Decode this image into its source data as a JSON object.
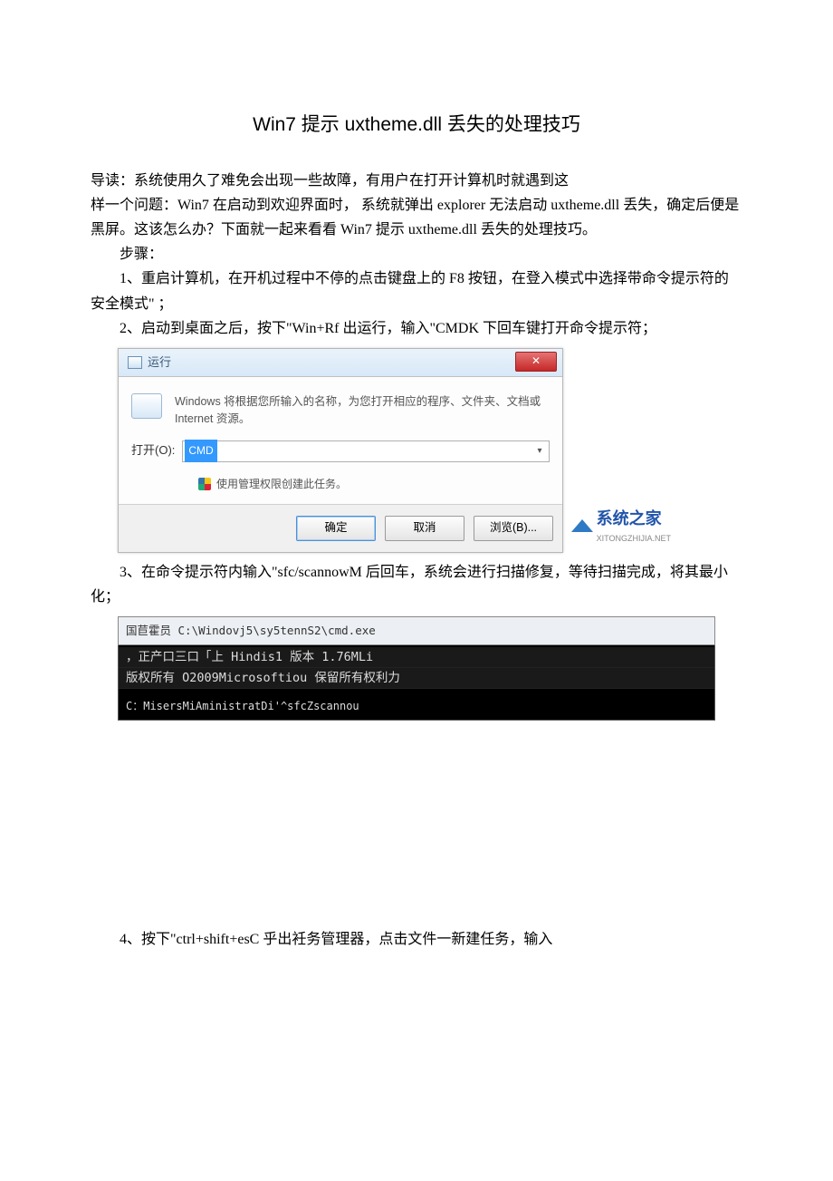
{
  "title": "Win7 提示 uxtheme.dll 丢失的处理技巧",
  "intro": {
    "p1": "导读：系统使用久了难免会出现一些故障，有用户在打开计算机时就遇到这",
    "p2": "样一个问题：Win7 在启动到欢迎界面时， 系统就弹出 explorer 无法启动 uxtheme.dll 丢失，确定后便是黑屏。这该怎么办？下面就一起来看看 Win7 提示 uxtheme.dll 丢失的处理技巧。"
  },
  "steps_header": "步骤：",
  "step1": "1、重启计算机，在开机过程中不停的点击键盘上的 F8 按钮，在登入模式中选择带命令提示符的安全模式\" ；",
  "step2": "2、启动到桌面之后，按下\"Win+Rf 出运行，输入\"CMDK 下回车键打开命令提示符；",
  "step3": "3、在命令提示符内输入\"sfc/scannowM 后回车，系统会进行扫描修复，等待扫描完成，将其最小化；",
  "step4": "4、按下\"ctrl+shift+esC 乎出衽务管理器，点击文件一新建任务，输入",
  "run_dialog": {
    "title": "运行",
    "close": "✕",
    "description": "Windows 将根据您所输入的名称，为您打开相应的程序、文件夹、文档或 Internet 资源。",
    "open_label": "打开(O):",
    "input_value": "CMD",
    "admin_note": "使用管理权限创建此任务。",
    "ok": "确定",
    "cancel": "取消",
    "browse": "浏览(B)...",
    "watermark": "系统之家",
    "watermark_sub": "XITONGZHIJIA.NET"
  },
  "cmd_window": {
    "title": "国苣霍员 C:\\Windovj5\\sy5tennS2\\cmd.exe",
    "line1": "，正产口三口「上 Hindis1 版本 1.76MLi",
    "line2": "版权所有 O2009Microsoftiou 保留所有权利力",
    "line3": "C：MisersMiAministratDi'^sfcZscannou"
  }
}
